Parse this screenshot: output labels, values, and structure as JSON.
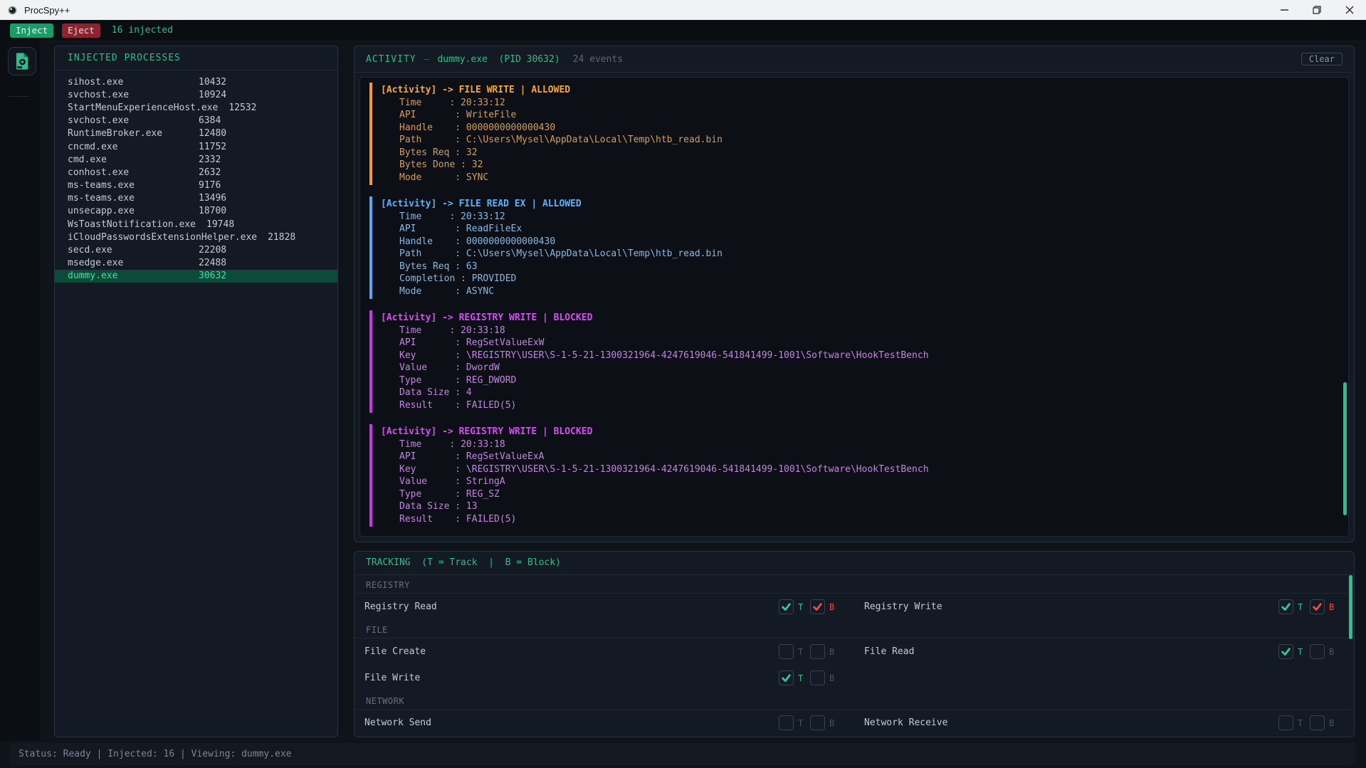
{
  "window": {
    "title": "ProcSpy++"
  },
  "toolbar": {
    "inject_label": "Inject",
    "eject_label": "Eject",
    "injected_count": "16 injected"
  },
  "icons": {
    "app": "app-orb-icon",
    "rail": "process-file-gear-icon",
    "minimize": "minimize-icon",
    "maximize": "restore-icon",
    "close": "close-icon",
    "checked": "checkmark-icon"
  },
  "process_panel": {
    "header": "INJECTED PROCESSES",
    "processes": [
      {
        "name": "sihost.exe",
        "pid": "10432",
        "selected": false
      },
      {
        "name": "svchost.exe",
        "pid": "10924",
        "selected": false
      },
      {
        "name": "StartMenuExperienceHost.exe",
        "pid": "12532",
        "selected": false
      },
      {
        "name": "svchost.exe",
        "pid": "6384",
        "selected": false
      },
      {
        "name": "RuntimeBroker.exe",
        "pid": "12480",
        "selected": false
      },
      {
        "name": "cncmd.exe",
        "pid": "11752",
        "selected": false
      },
      {
        "name": "cmd.exe",
        "pid": "2332",
        "selected": false
      },
      {
        "name": "conhost.exe",
        "pid": "2632",
        "selected": false
      },
      {
        "name": "ms-teams.exe",
        "pid": "9176",
        "selected": false
      },
      {
        "name": "ms-teams.exe",
        "pid": "13496",
        "selected": false
      },
      {
        "name": "unsecapp.exe",
        "pid": "18700",
        "selected": false
      },
      {
        "name": "WsToastNotification.exe",
        "pid": "19748",
        "selected": false
      },
      {
        "name": "iCloudPasswordsExtensionHelper.exe",
        "pid": "21828",
        "selected": false
      },
      {
        "name": "secd.exe",
        "pid": "22208",
        "selected": false
      },
      {
        "name": "msedge.exe",
        "pid": "22488",
        "selected": false
      },
      {
        "name": "dummy.exe",
        "pid": "30632",
        "selected": true
      }
    ]
  },
  "activity_panel": {
    "title": "ACTIVITY",
    "separator": "—",
    "process": "dummy.exe  (PID 30632)",
    "events_count": "24 events",
    "clear_label": "Clear",
    "entries": [
      {
        "color": "orange",
        "header": "[Activity] -> FILE WRITE | ALLOWED",
        "lines": [
          "Time     : 20:33:12",
          "API       : WriteFile",
          "Handle    : 0000000000000430",
          "Path      : C:\\Users\\Mysel\\AppData\\Local\\Temp\\htb_read.bin",
          "Bytes Req : 32",
          "Bytes Done : 32",
          "Mode      : SYNC"
        ]
      },
      {
        "color": "blue",
        "header": "[Activity] -> FILE READ EX | ALLOWED",
        "lines": [
          "Time     : 20:33:12",
          "API       : ReadFileEx",
          "Handle    : 0000000000000430",
          "Path      : C:\\Users\\Mysel\\AppData\\Local\\Temp\\htb_read.bin",
          "Bytes Req : 63",
          "Completion : PROVIDED",
          "Mode      : ASYNC"
        ]
      },
      {
        "color": "purple",
        "header": "[Activity] -> REGISTRY WRITE | BLOCKED",
        "lines": [
          "Time     : 20:33:18",
          "API       : RegSetValueExW",
          "Key       : \\REGISTRY\\USER\\S-1-5-21-1300321964-4247619046-541841499-1001\\Software\\HookTestBench",
          "Value     : DwordW",
          "Type      : REG_DWORD",
          "Data Size : 4",
          "Result    : FAILED(5)"
        ]
      },
      {
        "color": "purple",
        "header": "[Activity] -> REGISTRY WRITE | BLOCKED",
        "lines": [
          "Time     : 20:33:18",
          "API       : RegSetValueExA",
          "Key       : \\REGISTRY\\USER\\S-1-5-21-1300321964-4247619046-541841499-1001\\Software\\HookTestBench",
          "Value     : StringA",
          "Type      : REG_SZ",
          "Data Size : 13",
          "Result    : FAILED(5)"
        ]
      }
    ]
  },
  "tracking_panel": {
    "header": "TRACKING  (T = Track  |  B = Block)",
    "track_letter": "T",
    "block_letter": "B",
    "sections": [
      {
        "label": "REGISTRY",
        "rows": [
          {
            "left": {
              "label": "Registry Read",
              "track": true,
              "block": true
            },
            "right": {
              "label": "Registry Write",
              "track": true,
              "block": true
            }
          }
        ]
      },
      {
        "label": "FILE",
        "rows": [
          {
            "left": {
              "label": "File Create",
              "track": false,
              "block": false
            },
            "right": {
              "label": "File Read",
              "track": true,
              "block": false
            }
          },
          {
            "left": {
              "label": "File Write",
              "track": true,
              "block": false
            },
            "right": null
          }
        ]
      },
      {
        "label": "NETWORK",
        "rows": [
          {
            "left": {
              "label": "Network Send",
              "track": false,
              "block": false
            },
            "right": {
              "label": "Network Receive",
              "track": false,
              "block": false
            }
          }
        ]
      }
    ]
  },
  "statusbar": {
    "text": "Status: Ready | Injected: 16 | Viewing: dummy.exe"
  },
  "colors": {
    "accent_teal": "#2ebd8c",
    "inject_green": "#179e66",
    "eject_red": "#8e232f",
    "entry_orange": "#f5a838",
    "entry_blue": "#5fb0f5",
    "entry_purple": "#d44ef0",
    "check_green": "#2ece8e",
    "check_red": "#e85050",
    "selected_row_bg": "#0e4a3a",
    "selected_row_text": "#41dfa5",
    "titlebar_bg": "#f1f2f3"
  }
}
